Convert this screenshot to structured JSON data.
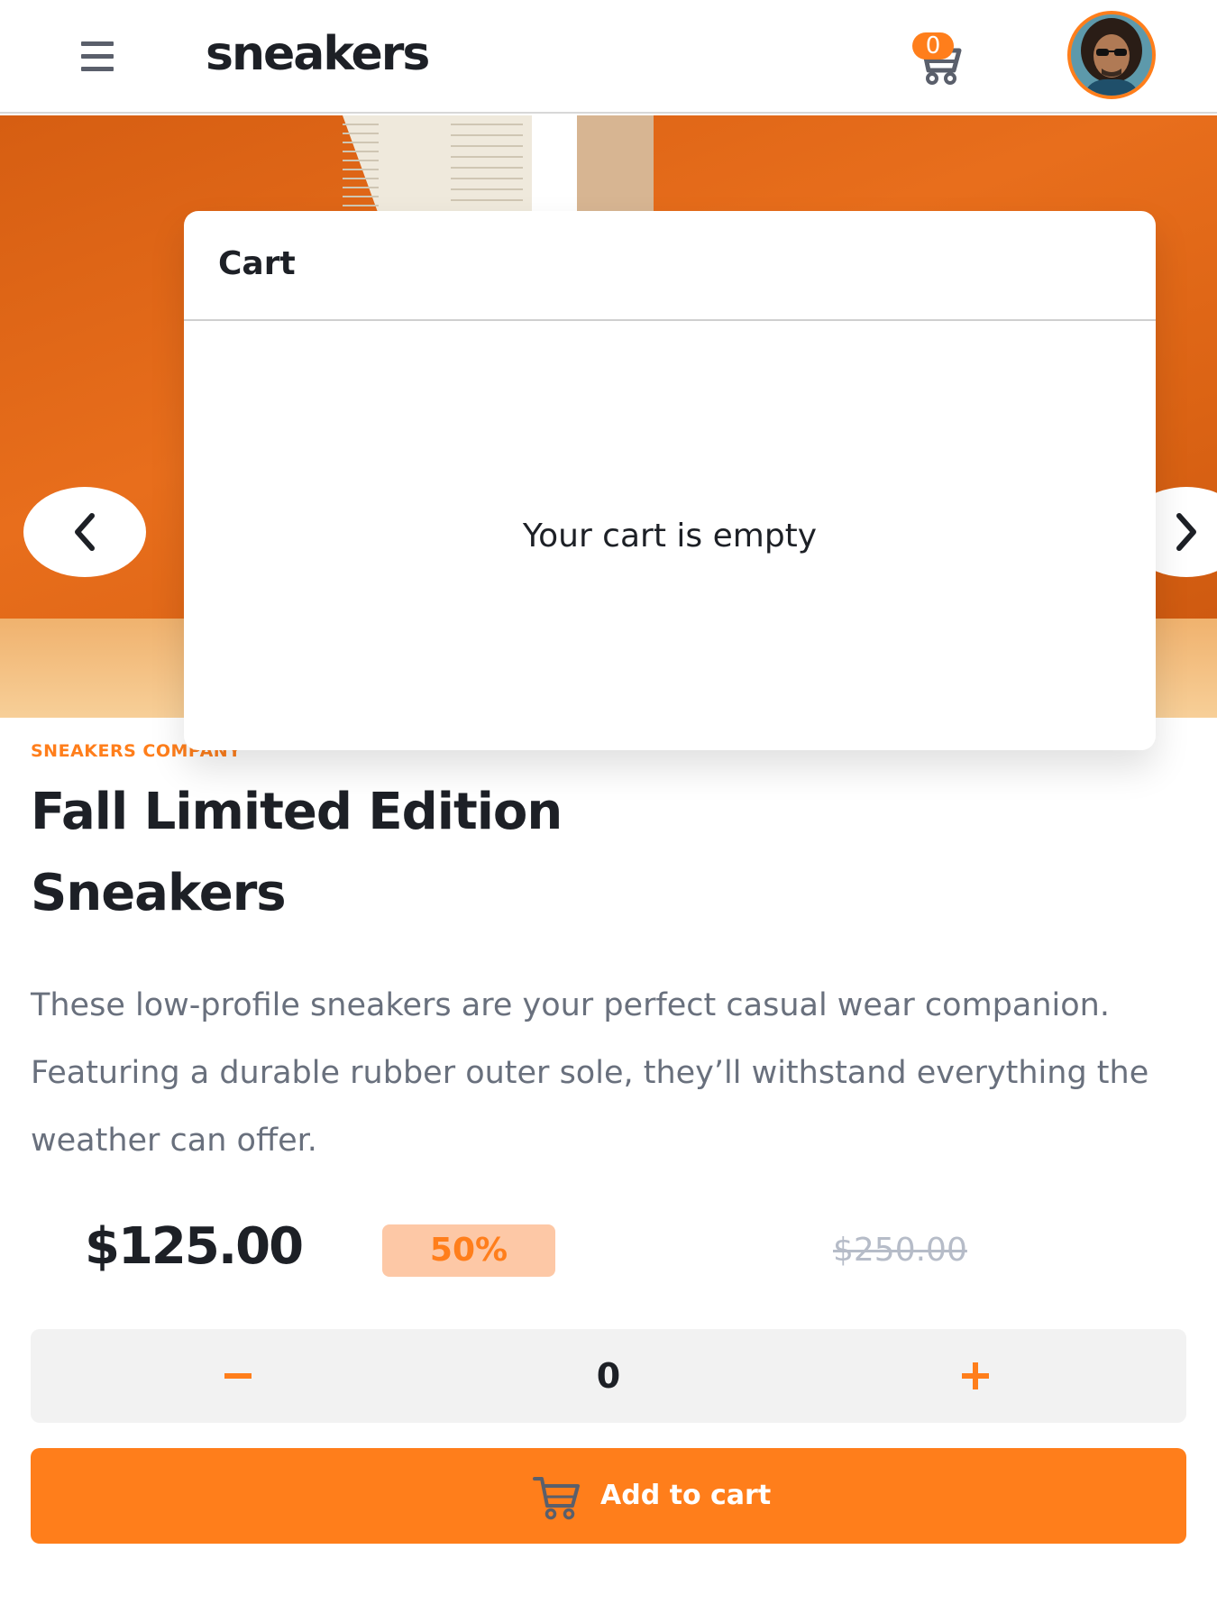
{
  "header": {
    "logo": "sneakers",
    "cart_count": "0",
    "menu_icon": "hamburger-icon",
    "cart_icon": "cart-icon"
  },
  "cart": {
    "title": "Cart",
    "empty_message": "Your cart is empty"
  },
  "gallery": {
    "prev_icon": "chevron-left-icon",
    "next_icon": "chevron-right-icon"
  },
  "product": {
    "company": "SNEAKERS COMPANY",
    "title": "Fall Limited Edition Sneakers",
    "description": "These low-profile sneakers are your perfect casual wear companion. Featuring a durable rubber outer sole, they’ll withstand everything the weather can offer.",
    "price": "$125.00",
    "discount": "50%",
    "original_price": "$250.00"
  },
  "quantity": {
    "value": "0"
  },
  "add_to_cart": {
    "label": "Add to cart"
  },
  "colors": {
    "accent": "#ff7e1b",
    "accent_pale": "#fdc8a6",
    "text_dark": "#1d2026",
    "text_grey": "#69707d",
    "text_light": "#b6bcc8"
  }
}
